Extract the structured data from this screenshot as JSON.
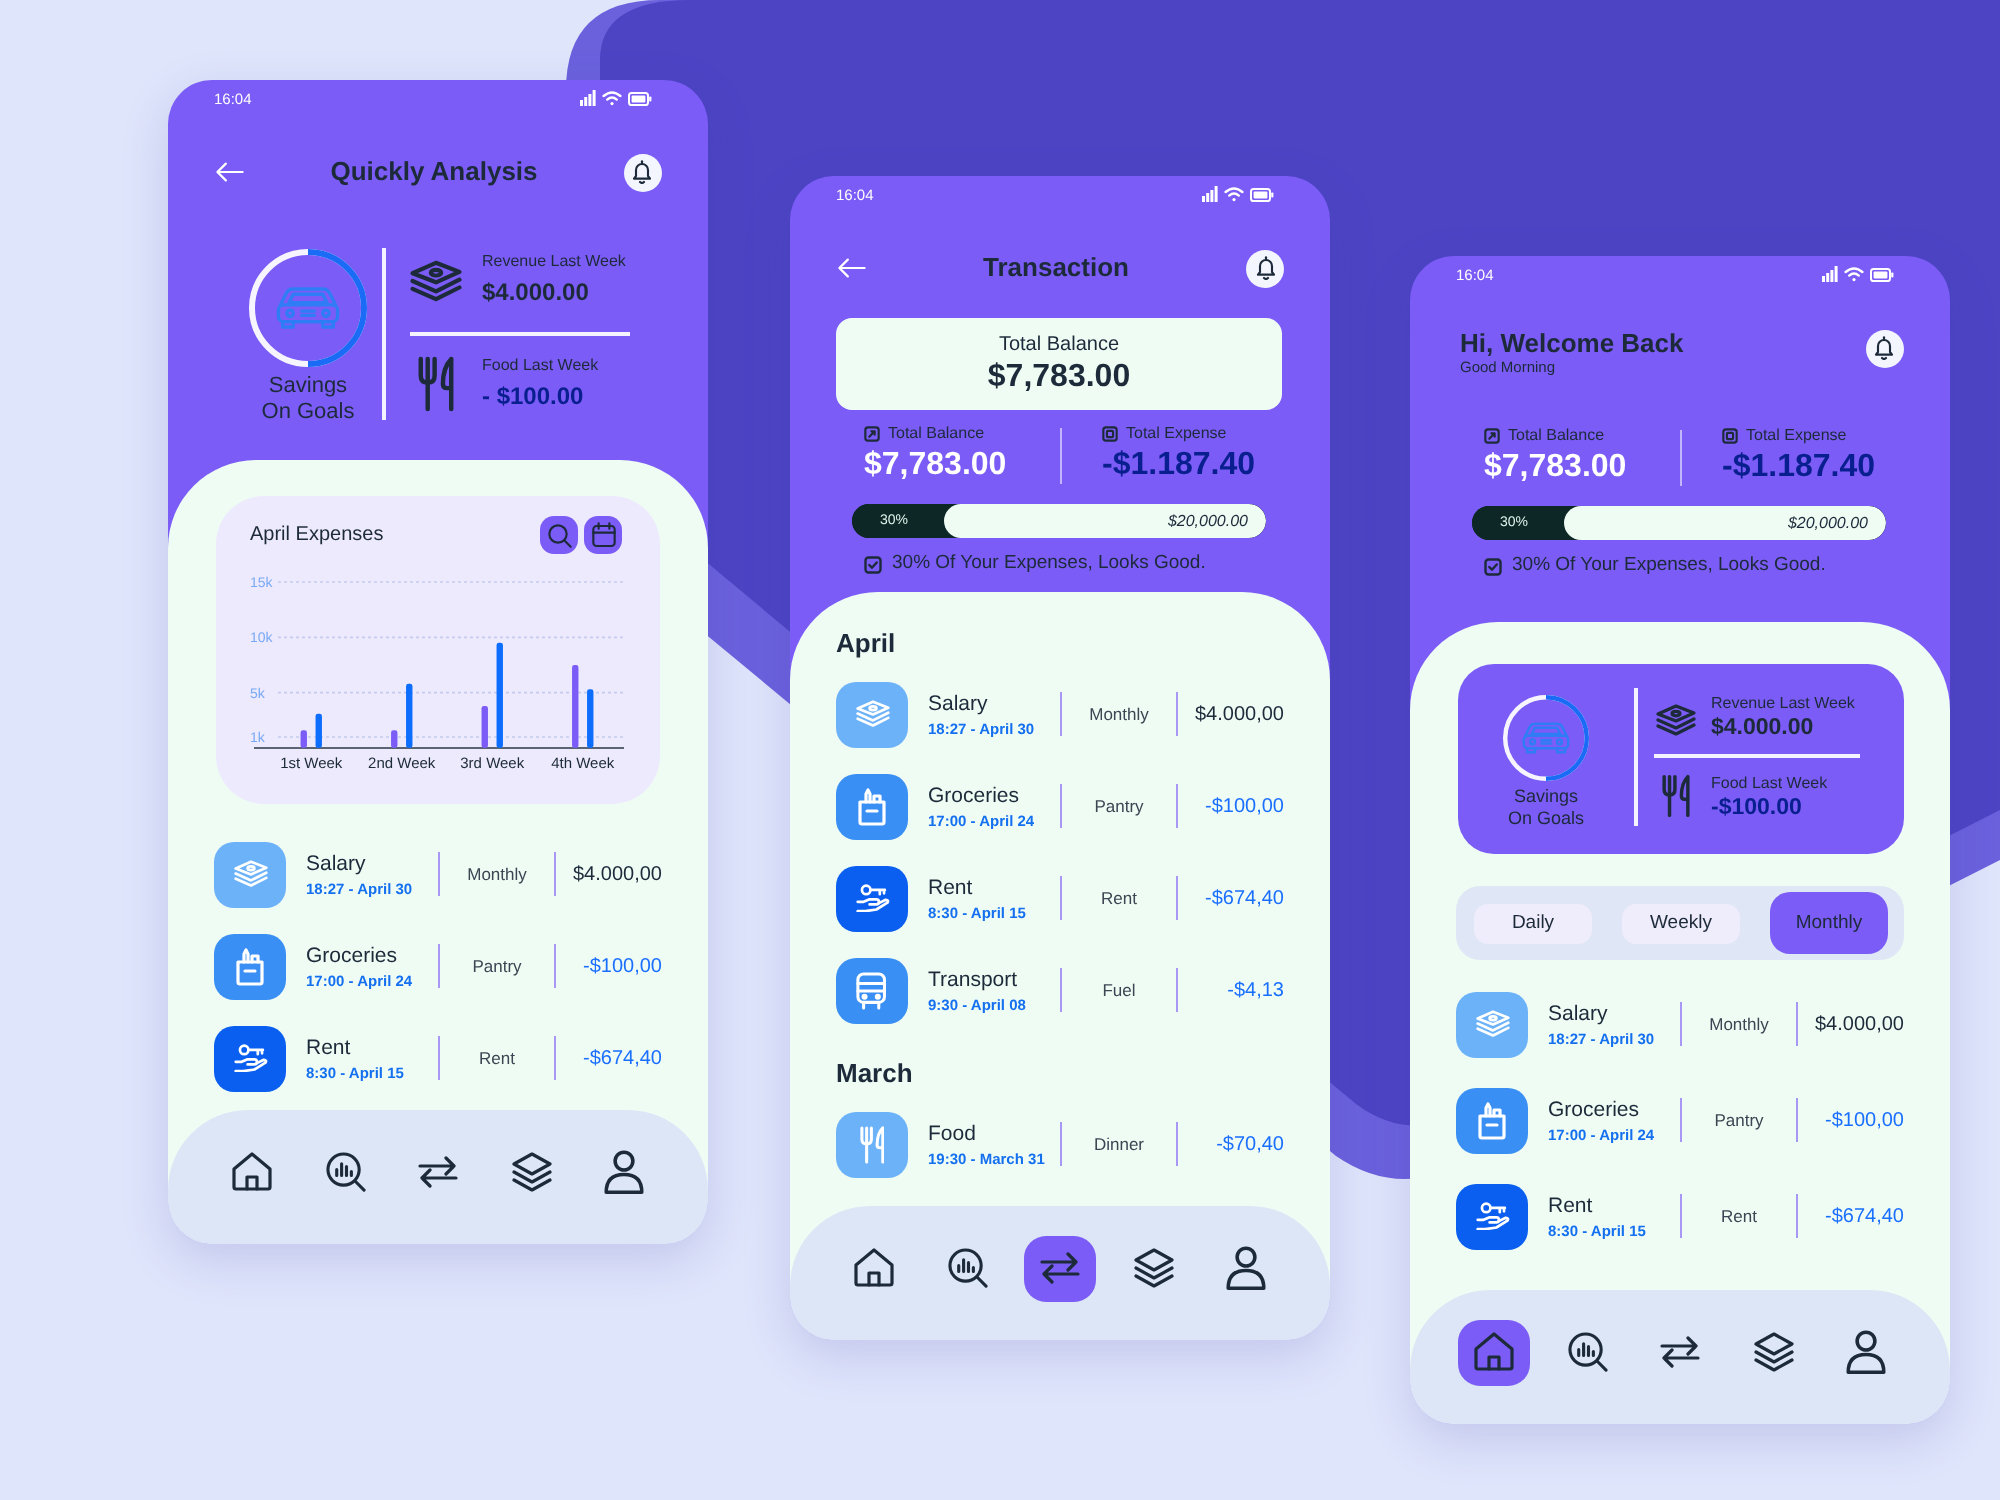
{
  "phones": [
    {
      "status_bar": {
        "time": "16:04"
      },
      "top": {
        "header": {
          "kind": "back",
          "title": "Quickly Analysis"
        },
        "summary": {
          "savings": {
            "label": "Savings On Goals",
            "level": 0.5
          },
          "revenue": {
            "label": "Revenue Last Week",
            "value": "$4.000.00"
          },
          "food": {
            "label": "Food Last Week",
            "value": "- $100.00"
          }
        }
      },
      "sheet": {
        "chart_card": {
          "chart_data": {
            "type": "bar",
            "title": "April Expenses",
            "grid": true,
            "categories": [
              "1st Week",
              "2nd Week",
              "3rd Week",
              "4th Week"
            ],
            "series": [
              {
                "color": "#7b5cf6",
                "values": [
                  1600,
                  1600,
                  3800,
                  7500
                ]
              },
              {
                "color": "#0d6efd",
                "values": [
                  3100,
                  5800,
                  9500,
                  5300
                ]
              }
            ],
            "ylim": [
              0,
              15000
            ],
            "yticks": [
              {
                "value": 1000,
                "label": "1k"
              },
              {
                "value": 5000,
                "label": "5k"
              },
              {
                "value": 10000,
                "label": "10k"
              },
              {
                "value": 15000,
                "label": "15k"
              }
            ]
          }
        },
        "transactions": [
          {
            "kind": "cash",
            "name": "Salary",
            "time": "18:27 - April 30",
            "category": "Monthly",
            "amount": "$4.000,00",
            "income": true
          },
          {
            "kind": "bag",
            "name": "Groceries",
            "time": "17:00 - April 24",
            "category": "Pantry",
            "amount": "-$100,00",
            "income": false
          },
          {
            "kind": "key",
            "name": "Rent",
            "time": "8:30 - April 15",
            "category": "Rent",
            "amount": "-$674,40",
            "income": false
          }
        ]
      },
      "nav": [
        {
          "kind": "home",
          "selected": false
        },
        {
          "kind": "analytics",
          "selected": false
        },
        {
          "kind": "transfer",
          "selected": false
        },
        {
          "kind": "layers",
          "selected": false
        },
        {
          "kind": "profile",
          "selected": false
        }
      ]
    },
    {
      "status_bar": {
        "time": "16:04"
      },
      "top": {
        "header": {
          "kind": "back",
          "title": "Transaction"
        },
        "balance_card": {
          "label": "Total Balance",
          "value": "$7,783.00"
        },
        "stats": [
          {
            "kind": "balance",
            "label": "Total Balance",
            "value": "$7,783.00"
          },
          {
            "kind": "expense",
            "label": "Total Expense",
            "value": "-$1.187.40"
          }
        ],
        "progress": {
          "level": 0.22,
          "percent": "30%",
          "goal": "$20,000.00"
        },
        "note": {
          "text": "30% Of Your Expenses, Looks Good."
        }
      },
      "sheet": {
        "groups": [
          {
            "title": "April",
            "transactions": [
              {
                "kind": "cash",
                "name": "Salary",
                "time": "18:27 - April 30",
                "category": "Monthly",
                "amount": "$4.000,00",
                "income": true
              },
              {
                "kind": "bag",
                "name": "Groceries",
                "time": "17:00 - April 24",
                "category": "Pantry",
                "amount": "-$100,00",
                "income": false
              },
              {
                "kind": "key",
                "name": "Rent",
                "time": "8:30 - April 15",
                "category": "Rent",
                "amount": "-$674,40",
                "income": false
              },
              {
                "kind": "bus",
                "name": "Transport",
                "time": "9:30 - April 08",
                "category": "Fuel",
                "amount": "-$4,13",
                "income": false
              }
            ]
          },
          {
            "title": "March",
            "transactions": [
              {
                "kind": "cutlery",
                "name": "Food",
                "time": "19:30 - March 31",
                "category": "Dinner",
                "amount": "-$70,40",
                "income": false
              }
            ]
          }
        ]
      },
      "nav": [
        {
          "kind": "home",
          "selected": false
        },
        {
          "kind": "analytics",
          "selected": false
        },
        {
          "kind": "transfer",
          "selected": true
        },
        {
          "kind": "layers",
          "selected": false
        },
        {
          "kind": "profile",
          "selected": false
        }
      ]
    },
    {
      "status_bar": {
        "time": "16:04"
      },
      "top": {
        "header": {
          "kind": "greeting",
          "title": "Hi, Welcome Back",
          "subtitle": "Good Morning"
        },
        "stats": [
          {
            "kind": "balance",
            "label": "Total Balance",
            "value": "$7,783.00"
          },
          {
            "kind": "expense",
            "label": "Total Expense",
            "value": "-$1.187.40"
          }
        ],
        "progress": {
          "level": 0.22,
          "percent": "30%",
          "goal": "$20,000.00"
        },
        "note": {
          "text": "30% Of Your Expenses, Looks Good."
        }
      },
      "sheet": {
        "summary": {
          "savings": {
            "label": "Savings On Goals",
            "level": 0.5
          },
          "revenue": {
            "label": "Revenue Last Week",
            "value": "$4.000.00"
          },
          "food": {
            "label": "Food Last Week",
            "value": "-$100.00"
          }
        },
        "tabs": [
          {
            "label": "Daily",
            "selected": false
          },
          {
            "label": "Weekly",
            "selected": false
          },
          {
            "label": "Monthly",
            "selected": true
          }
        ],
        "transactions": [
          {
            "kind": "cash",
            "name": "Salary",
            "time": "18:27 - April 30",
            "category": "Monthly",
            "amount": "$4.000,00",
            "income": true
          },
          {
            "kind": "bag",
            "name": "Groceries",
            "time": "17:00 - April 24",
            "category": "Pantry",
            "amount": "-$100,00",
            "income": false
          },
          {
            "kind": "key",
            "name": "Rent",
            "time": "8:30 - April 15",
            "category": "Rent",
            "amount": "-$674,40",
            "income": false
          }
        ]
      },
      "nav": [
        {
          "kind": "home",
          "selected": true
        },
        {
          "kind": "analytics",
          "selected": false
        },
        {
          "kind": "transfer",
          "selected": false
        },
        {
          "kind": "layers",
          "selected": false
        },
        {
          "kind": "profile",
          "selected": false
        }
      ]
    }
  ]
}
